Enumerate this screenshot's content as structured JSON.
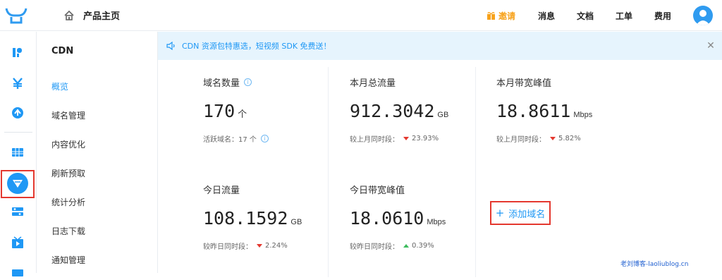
{
  "header": {
    "home_title": "产品主页",
    "nav": [
      {
        "label": "邀请"
      },
      {
        "label": "消息"
      },
      {
        "label": "文档"
      },
      {
        "label": "工单"
      },
      {
        "label": "费用"
      }
    ]
  },
  "sidebar": {
    "title": "CDN",
    "items": [
      {
        "label": "概览",
        "active": true
      },
      {
        "label": "域名管理"
      },
      {
        "label": "内容优化"
      },
      {
        "label": "刷新预取"
      },
      {
        "label": "统计分析"
      },
      {
        "label": "日志下载"
      },
      {
        "label": "通知管理"
      }
    ]
  },
  "notice": {
    "text": "CDN 资源包特惠选，短视频 SDK 免费送！"
  },
  "stats": [
    {
      "label": "域名数量",
      "value": "170",
      "unit": "个",
      "sub_label": "活跃域名：17 个",
      "trend": "none",
      "change": ""
    },
    {
      "label": "本月总流量",
      "value": "912.3042",
      "unit": "GB",
      "sub_label": "较上月同时段：",
      "trend": "down",
      "change": "23.93%"
    },
    {
      "label": "本月带宽峰值",
      "value": "18.8611",
      "unit": "Mbps",
      "sub_label": "较上月同时段：",
      "trend": "down",
      "change": "5.82%"
    },
    {
      "label": "今日流量",
      "value": "108.1592",
      "unit": "GB",
      "sub_label": "较昨日同时段：",
      "trend": "down",
      "change": "2.24%"
    },
    {
      "label": "今日带宽峰值",
      "value": "18.0610",
      "unit": "Mbps",
      "sub_label": "较昨日同时段：",
      "trend": "up",
      "change": "0.39%"
    }
  ],
  "add_domain": {
    "plus": "+",
    "label": "添加域名"
  },
  "watermark": "老刘博客-laoliublog.cn",
  "colors": {
    "accent": "#1f98f5",
    "highlight": "#e4382f",
    "invite": "#f7a21b",
    "up": "#3cbc5d"
  }
}
